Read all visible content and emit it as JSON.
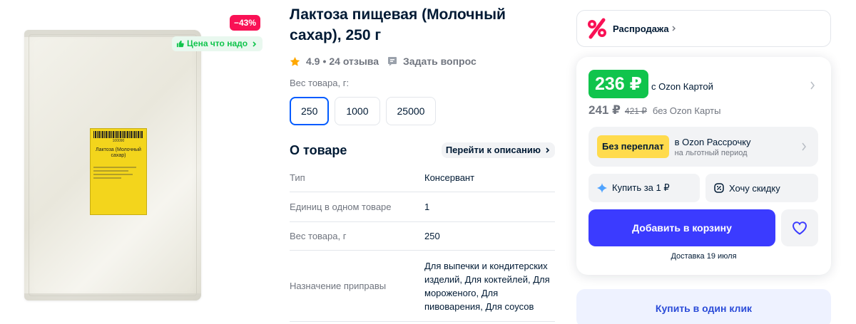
{
  "gallery": {
    "discount_badge": "−43%",
    "good_price_badge": "Цена что надо",
    "bag_label_title": "Лактоза (Молочный сахар)",
    "bag_label_code": "100090"
  },
  "product": {
    "title": "Лактоза пищевая (Молочный сахар), 250 г",
    "rating": "4.9",
    "rating_sep": "•",
    "reviews": "24 отзыва",
    "ask_question": "Задать вопрос",
    "weight_label": "Вес товара, г:",
    "weights": [
      "250",
      "1000",
      "25000"
    ],
    "selected_weight": "250"
  },
  "about": {
    "title": "О товаре",
    "go_to_description": "Перейти к описанию",
    "specs": [
      {
        "name": "Тип",
        "value": "Консервант"
      },
      {
        "name": "Единиц в одном товаре",
        "value": "1"
      },
      {
        "name": "Вес товара, г",
        "value": "250"
      },
      {
        "name": "Назначение приправы",
        "value": "Для выпечки и кондитерских изделий, Для коктейлей, Для мороженого, Для пивоварения, Для соусов"
      }
    ]
  },
  "sidebar": {
    "sale_label": "Распродажа",
    "ozon_card_price": "236 ₽",
    "ozon_card_label": "с Ozon Картой",
    "price": "241 ₽",
    "old_price": "421 ₽",
    "price_note": "без Ozon Карты",
    "no_overpay": "Без переплат",
    "installment_line1": "в Ozon Рассрочку",
    "installment_line2": "на льготный период",
    "buy_for_1": "Купить за 1 ₽",
    "want_discount": "Хочу скидку",
    "add_to_cart": "Добавить в корзину",
    "delivery": "Доставка 19 июля",
    "one_click": "Купить в один клик"
  },
  "colors": {
    "accent_blue": "#3b3bff",
    "ozon_green": "#10c44c",
    "discount_pink": "#f91155",
    "no_overpay_yellow": "#ffdb4d"
  }
}
